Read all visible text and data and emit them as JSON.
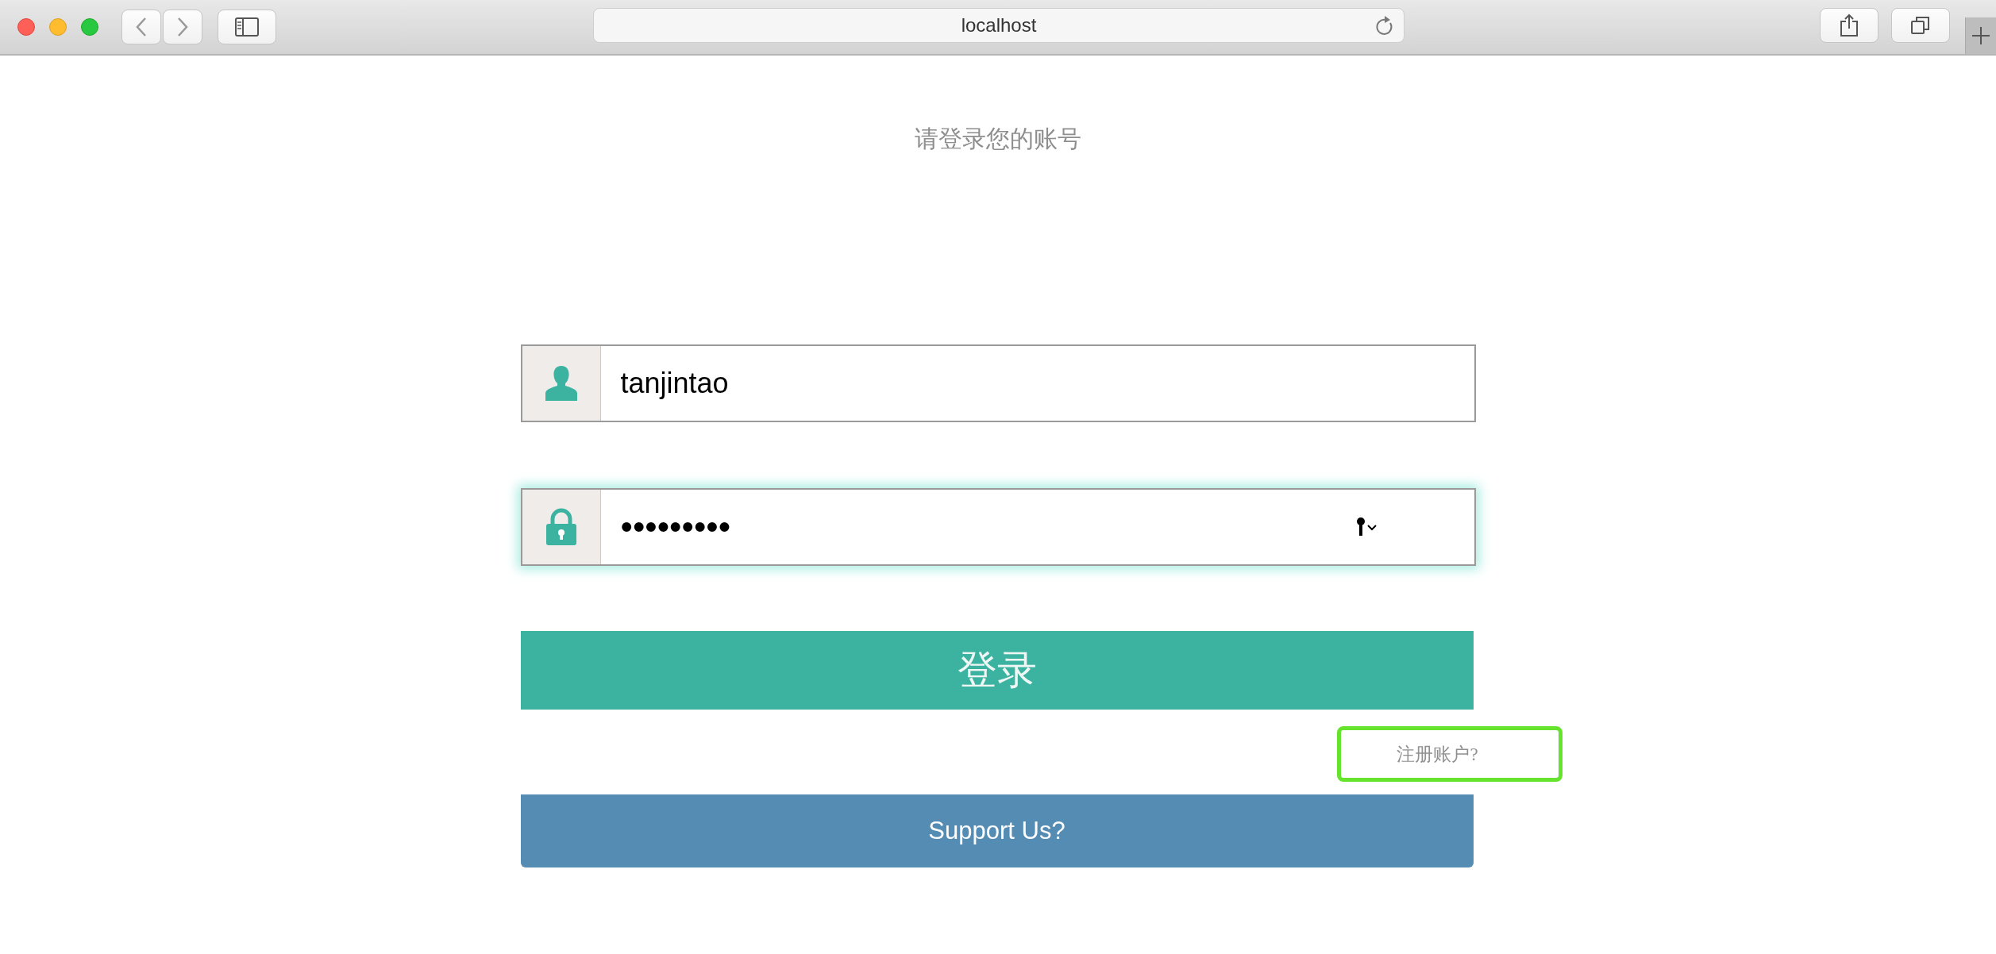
{
  "browser": {
    "address": "localhost"
  },
  "title": "请登录您的账号",
  "fields": [
    {
      "kind": "text",
      "value": "tanjintao",
      "focused": false
    },
    {
      "kind": "password",
      "value": "•••••••••",
      "focused": true
    }
  ],
  "login_button": "登录",
  "register_link": "注册账户?",
  "support_button": "Support Us?"
}
